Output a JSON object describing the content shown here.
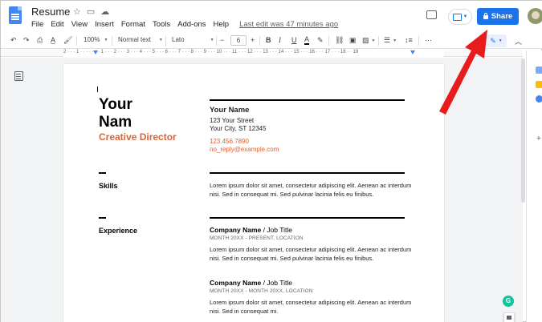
{
  "header": {
    "doc_title": "Resume",
    "menu": [
      "File",
      "Edit",
      "View",
      "Insert",
      "Format",
      "Tools",
      "Add-ons",
      "Help"
    ],
    "last_edit": "Last edit was 47 minutes ago",
    "share_label": "Share"
  },
  "toolbar": {
    "zoom": "100%",
    "style": "Normal text",
    "font": "Lato",
    "font_size": "6",
    "bold": "B",
    "italic": "I",
    "underline": "U",
    "text_color": "A",
    "more": "⋯"
  },
  "ruler": {
    "numbers": "2 · · · 1 · · · · · · · 1 · · · 2 · · · 3 · · · 4 · · · 5 · · · 6 · · · 7 · · · 8 · · · 9 · · · 10 · · · 11 · · · 12 · · · 13 · · · 14 · · · 15 · · · 16 · · · 17 · · · 18 · · 19"
  },
  "document": {
    "name_line1": "Your",
    "name_line2": "Nam",
    "role": "Creative Director",
    "contact_name": "Your Name",
    "street": "123 Your Street",
    "city": "Your City, ST 12345",
    "phone": "123.456.7890",
    "email": "no_reply@example.com",
    "skills_label": "Skills",
    "skills_text": "Lorem ipsum dolor sit amet, consectetur adipiscing elit. Aenean ac interdum nisi. Sed in consequat mi. Sed pulvinar lacinia felis eu finibus.",
    "experience_label": "Experience",
    "jobs": [
      {
        "company": "Company Name",
        "title": " / Job Title",
        "dates": "MONTH 20XX - PRESENT,  LOCATION",
        "desc": "Lorem ipsum dolor sit amet, consectetur adipiscing elit. Aenean ac interdum nisi. Sed in consequat mi. Sed pulvinar lacinia felis eu finibus."
      },
      {
        "company": "Company Name",
        "title": " / Job Title",
        "dates": "MONTH 20XX - MONTH 20XX,  LOCATION",
        "desc": "Lorem ipsum dolor sit amet, consectetur adipiscing elit. Aenean ac interdum nisi. Sed in consequat mi."
      }
    ]
  },
  "grammarly_letter": "G",
  "colors": {
    "accent": "#e06132",
    "share_blue": "#1a73e8",
    "arrow_red": "#e81c1c"
  }
}
